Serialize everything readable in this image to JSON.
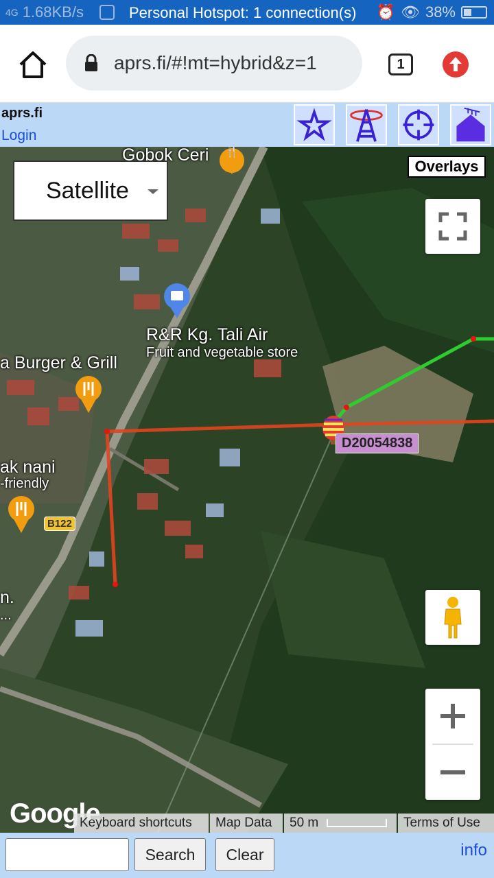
{
  "status_bar": {
    "network": "4G",
    "speed": "1.68KB/s",
    "hotspot_text": "Personal Hotspot: 1 connection(s)",
    "battery": "38%",
    "battery_level": 0.38
  },
  "browser": {
    "url": "aprs.fi/#!mt=hybrid&z=1",
    "tab_count": "1"
  },
  "aprs_header": {
    "title": "aprs.fi",
    "login_label": "Login",
    "tools": [
      "star-icon",
      "antenna-tower-icon",
      "crosshair-icon",
      "house-antenna-icon"
    ]
  },
  "map": {
    "map_type": "Satellite",
    "overlays_label": "Overlays",
    "places": {
      "gobok": "Gobok Ceri",
      "rr_name": "R&R Kg. Tali Air",
      "rr_category": "Fruit and vegetable store",
      "burger": "a Burger & Grill",
      "nani_name": "ak nani",
      "nani_sub": "-friendly",
      "partial_name": "n.",
      "partial_sub": "..."
    },
    "road_label": "B122",
    "station_callsign": "D20054838",
    "google_logo": "Google",
    "attribution": {
      "keyboard": "Keyboard shortcuts",
      "map_data": "Map Data",
      "scale": "50 m",
      "terms": "Terms of Use"
    },
    "colors": {
      "track_red": "#e0451f",
      "track_green": "#2ecc2e"
    }
  },
  "bottom_bar": {
    "search_value": "",
    "search_label": "Search",
    "clear_label": "Clear",
    "info_label": "info"
  }
}
